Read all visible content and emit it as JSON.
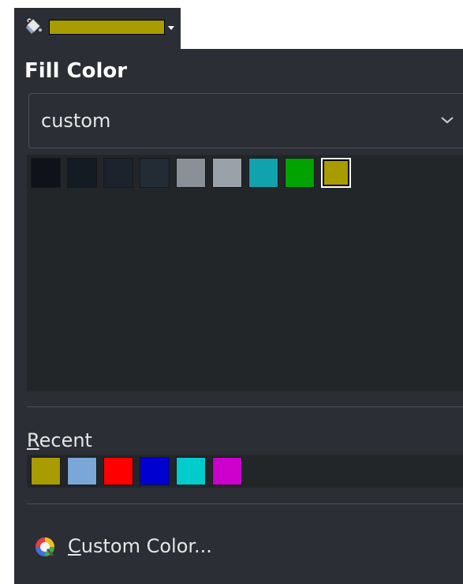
{
  "toolbar": {
    "icon": "paint-bucket-icon",
    "current_color": "#a89c00",
    "arrow_icon": "dropdown-arrow-icon"
  },
  "popup": {
    "title": "Fill Color",
    "palette": {
      "selected": "custom",
      "chevron_icon": "chevron-down-icon"
    },
    "swatches": [
      {
        "color": "#0f1319",
        "selected": false
      },
      {
        "color": "#151b23",
        "selected": false
      },
      {
        "color": "#1c232c",
        "selected": false
      },
      {
        "color": "#232b35",
        "selected": false
      },
      {
        "color": "#8a9098",
        "selected": false
      },
      {
        "color": "#9aa1a9",
        "selected": false
      },
      {
        "color": "#10a3ad",
        "selected": false
      },
      {
        "color": "#00a300",
        "selected": false
      },
      {
        "color": "#a89c00",
        "selected": true
      }
    ],
    "recent": {
      "label_prefix": "R",
      "label_rest": "ecent",
      "colors": [
        "#a89c00",
        "#7aa6d8",
        "#ff0000",
        "#0000d0",
        "#00cccc",
        "#cc00cc"
      ]
    },
    "custom_button": {
      "icon": "color-wheel-icon",
      "label_prefix": "C",
      "label_rest": "ustom Color..."
    }
  }
}
